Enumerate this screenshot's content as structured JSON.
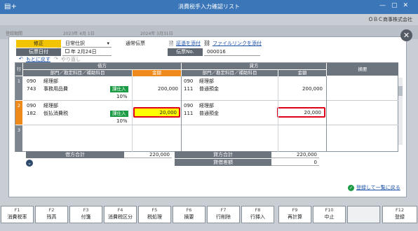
{
  "window": {
    "title": "消費税手入力確認リスト",
    "company": "ＯＢＣ商事株式会社"
  },
  "background": {
    "label1": "登録期間",
    "date_from": "2023年 4月 1日",
    "date_to": "2024年 3月31日"
  },
  "form": {
    "correction_label": "修正",
    "journal_type": "日常仕訳",
    "slip_type": "通常伝票",
    "date_label": "伝票日付",
    "date_value": "年 2月24日",
    "slip_no_label": "伝票No.",
    "slip_no_value": "000016",
    "attach_evidence": "証憑を添付",
    "attach_file_link": "ファイルリンクを添付",
    "undo": "もとに戻す",
    "redo": "やり直し"
  },
  "grid": {
    "headers": {
      "row": "行",
      "debit": "借方",
      "credit": "貸方",
      "dept_account_sub": "部門／勘定科目／補助科目",
      "amount": "金額",
      "summary": "摘要"
    },
    "rows": [
      {
        "num": "1",
        "debit_dept_code": "090",
        "debit_dept": "経理部",
        "debit_acct_code": "743",
        "debit_acct": "事務用品費",
        "tax_tag": "課仕入",
        "tax_rate": "10%",
        "debit_amount": "200,000",
        "credit_dept_code": "090",
        "credit_dept": "経理部",
        "credit_acct_code": "111",
        "credit_acct": "普通預金",
        "credit_amount": "200,000"
      },
      {
        "num": "2",
        "debit_dept_code": "090",
        "debit_dept": "経理部",
        "debit_acct_code": "182",
        "debit_acct": "仮払消費税",
        "tax_tag": "課仕入",
        "tax_rate": "10%",
        "debit_amount": "20,000",
        "credit_dept_code": "090",
        "credit_dept": "経理部",
        "credit_acct_code": "111",
        "credit_acct": "普通預金",
        "credit_amount": "20,000"
      },
      {
        "num": "3"
      }
    ]
  },
  "totals": {
    "debit_total_label": "借方合計",
    "debit_total": "220,000",
    "credit_total_label": "貸方合計",
    "credit_total": "220,000",
    "diff_label": "貸借差額",
    "diff": "0"
  },
  "register_link": "登録して一覧に戻る",
  "fkeys": [
    {
      "key": "F1",
      "label": "消費税率"
    },
    {
      "key": "F2",
      "label": "残高"
    },
    {
      "key": "F3",
      "label": "付箋"
    },
    {
      "key": "F4",
      "label": "消費税区分"
    },
    {
      "key": "F5",
      "label": "税処理"
    },
    {
      "key": "F6",
      "label": "摘要"
    },
    {
      "key": "F7",
      "label": "行削除"
    },
    {
      "key": "F8",
      "label": "行挿入"
    },
    {
      "key": "F9",
      "label": "再計算"
    },
    {
      "key": "F10",
      "label": "中止"
    },
    {
      "key": "",
      "label": ""
    },
    {
      "key": "F12",
      "label": "登録"
    }
  ],
  "colors": {
    "titlebar": "#3a76b8",
    "accent_orange": "#ee8a1b",
    "tag_green": "#1c9b45",
    "highlight_red": "#e1001a"
  }
}
